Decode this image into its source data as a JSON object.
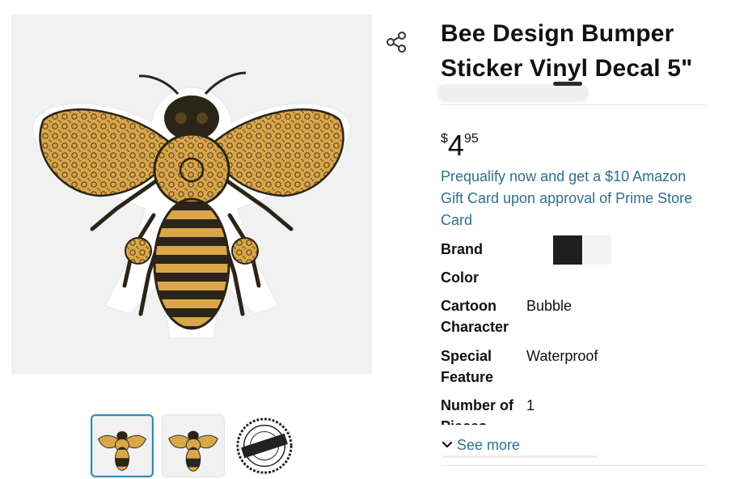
{
  "product": {
    "title": "Bee Design Bumper Sticker Vinyl Decal 5\"",
    "price": {
      "symbol": "$",
      "whole": "4",
      "fraction": "95"
    },
    "prequalify_text": "Prequalify now and get a $10 Amazon Gift Card upon approval of Prime Store Card"
  },
  "specs": [
    {
      "label": "Brand",
      "value": ""
    },
    {
      "label": "Color",
      "value": ""
    },
    {
      "label": "Cartoon Character",
      "value": "Bubble"
    },
    {
      "label": "Special Feature",
      "value": "Waterproof"
    },
    {
      "label": "Number of Pieces",
      "value": "1"
    }
  ],
  "see_more_label": "See more",
  "icons": {
    "share": "share-icon",
    "chevron": "chevron-down-icon"
  },
  "colors": {
    "link": "#2f6f8d",
    "selected_thumb_border": "#2f8ab9",
    "bee_gold": "#d9a64a",
    "bee_dark": "#2b2418"
  }
}
